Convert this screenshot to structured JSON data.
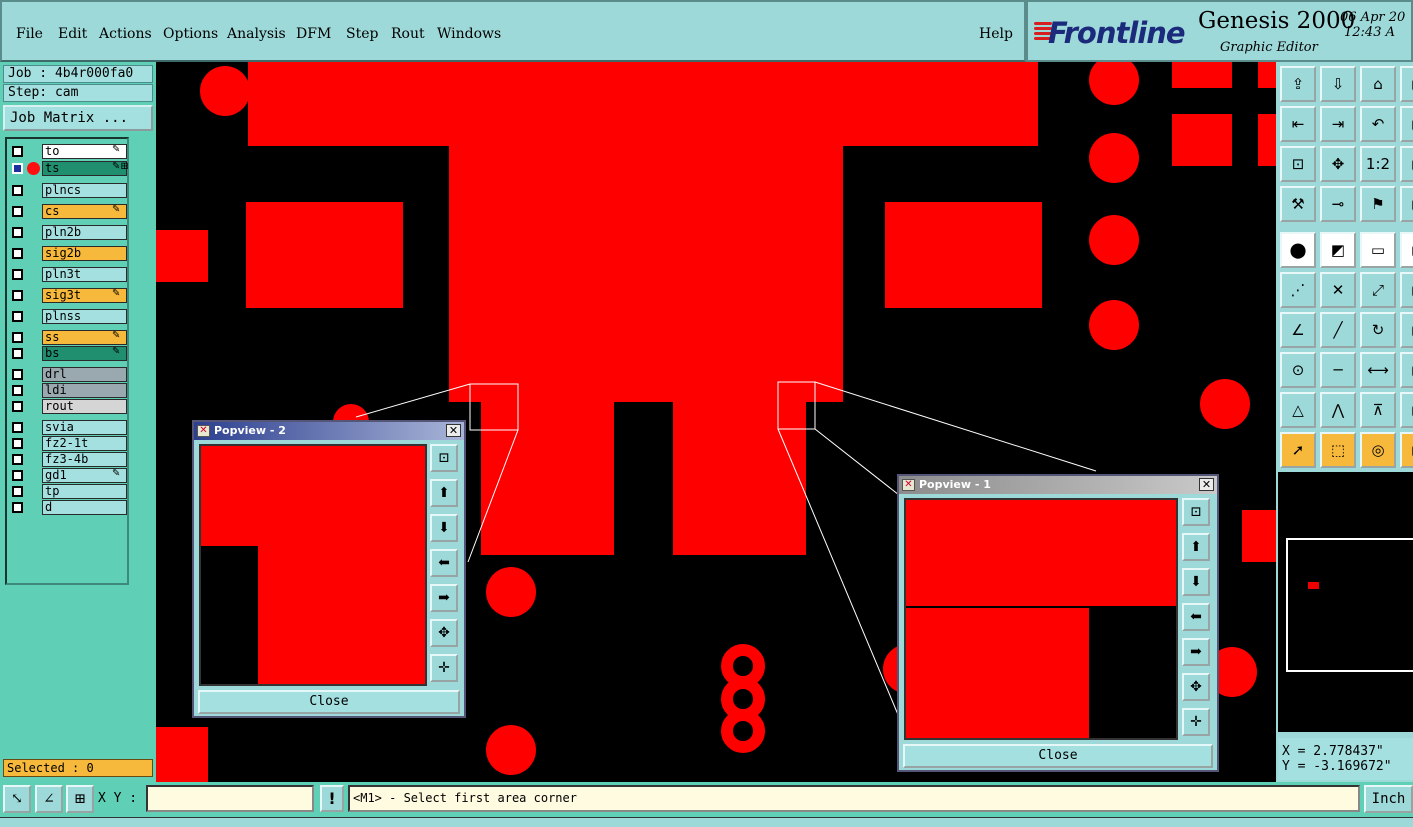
{
  "menu": [
    "File",
    "Edit",
    "Actions",
    "Options",
    "Analysis",
    "DFM",
    "Step",
    "Rout",
    "Windows"
  ],
  "help": "Help",
  "brand": {
    "logo": "Frontline",
    "product": "Genesis 2000",
    "subtitle": "Graphic Editor",
    "date": "06 Apr 20",
    "time": "12:43 A"
  },
  "job": {
    "job_label": "Job : 4b4r000fa0",
    "step_label": "Step: cam",
    "matrix_button": "Job Matrix ..."
  },
  "layers": [
    {
      "name": "to",
      "color": "#ffffff",
      "mark": "✎"
    },
    {
      "name": "ts",
      "color": "#1f8f6f",
      "mark": "✎⊞",
      "active": true
    },
    {
      "name": "plncs",
      "color": "#a5e0e0",
      "mark": ""
    },
    {
      "name": "cs",
      "color": "#f7b93c",
      "mark": "✎"
    },
    {
      "name": "pln2b",
      "color": "#a5e0e0",
      "mark": ""
    },
    {
      "name": "sig2b",
      "color": "#f7b93c",
      "mark": ""
    },
    {
      "name": "pln3t",
      "color": "#a5e0e0",
      "mark": ""
    },
    {
      "name": "sig3t",
      "color": "#f7b93c",
      "mark": "✎"
    },
    {
      "name": "plnss",
      "color": "#a5e0e0",
      "mark": ""
    },
    {
      "name": "ss",
      "color": "#f7b93c",
      "mark": "✎"
    },
    {
      "name": "bs",
      "color": "#1f8f6f",
      "mark": "✎"
    },
    {
      "name": "drl",
      "color": "#9aa9b0",
      "mark": ""
    },
    {
      "name": "ldi",
      "color": "#9aa9b0",
      "mark": ""
    },
    {
      "name": "rout",
      "color": "#d5d5d5",
      "mark": ""
    },
    {
      "name": "svia",
      "color": "#a5e0e0",
      "mark": ""
    },
    {
      "name": "fz2-1t",
      "color": "#a5e0e0",
      "mark": ""
    },
    {
      "name": "fz3-4b",
      "color": "#a5e0e0",
      "mark": ""
    },
    {
      "name": "gd1",
      "color": "#a5e0e0",
      "mark": "✎"
    },
    {
      "name": "tp",
      "color": "#a5e0e0",
      "mark": ""
    },
    {
      "name": "d",
      "color": "#a5e0e0",
      "mark": ""
    }
  ],
  "selected": "Selected : 0",
  "popview1": {
    "title": "Popview - 1",
    "close": "Close"
  },
  "popview2": {
    "title": "Popview - 2",
    "close": "Close"
  },
  "coords": {
    "x": "X = 2.778437\"",
    "y": "Y = -3.169672\""
  },
  "bottom": {
    "xy_label": "X Y :",
    "xy_value": "",
    "excl": "!",
    "message": "<M1> - Select first area corner",
    "unit": "Inch"
  },
  "colors": {
    "copper": "#ff0000",
    "canvas": "#000000",
    "panel": "#9ed9d9",
    "side": "#5fcfb5"
  },
  "right_tools": [
    "open-step-icon",
    "save-icon",
    "home-icon",
    "window-icon",
    "prev-icon",
    "next-icon",
    "undo-view-icon",
    "more-icon",
    "zoom-fit-icon",
    "zoom-center-icon",
    "scale-1-2-icon",
    "more2-icon",
    "probe-icon",
    "measure-icon",
    "traffic-light-icon",
    "more3-icon",
    "select-icon",
    "shape-icon",
    "ruler-icon",
    "more4-icon",
    "connect-icon",
    "cross-icon",
    "link-icon",
    "more5-icon",
    "angle-icon",
    "line-icon",
    "arc-icon",
    "more6-icon",
    "snap-icon",
    "segment-icon",
    "dimension-icon",
    "more7-icon",
    "triangle-icon",
    "triangle2-icon",
    "triangle3-icon",
    "more8-icon",
    "pointer-icon",
    "pointer-box-icon",
    "pointer-circle-icon",
    "more9-icon"
  ]
}
